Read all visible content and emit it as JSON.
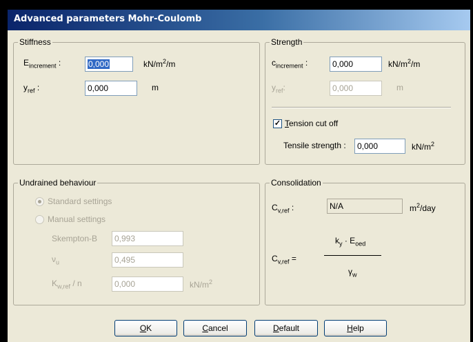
{
  "window": {
    "title": "Advanced parameters Mohr-Coulomb"
  },
  "stiffness": {
    "legend": "Stiffness",
    "e_increment": {
      "symbol": "E",
      "sub": "increment",
      "colon": " :",
      "value": "0,000",
      "unit": "kN/m",
      "unit_sup": "2",
      "unit_tail": "/m"
    },
    "y_ref": {
      "symbol": "y",
      "sub": "ref",
      "colon": " :",
      "value": "0,000",
      "unit": "m"
    }
  },
  "strength": {
    "legend": "Strength",
    "c_increment": {
      "symbol": "c",
      "sub": "increment",
      "colon": " :",
      "value": "0,000",
      "unit": "kN/m",
      "unit_sup": "2",
      "unit_tail": "/m"
    },
    "y_ref": {
      "symbol": "y",
      "sub": "ref",
      "colon": ":",
      "value": "0,000",
      "unit": "m"
    },
    "tension_cutoff": {
      "label_first": "T",
      "label_rest": "ension cut off",
      "checked": true,
      "check_glyph": "✓"
    },
    "tensile_strength": {
      "label": "Tensile strength :",
      "value": "0,000",
      "unit": "kN/m",
      "unit_sup": "2"
    }
  },
  "undrained": {
    "legend": "Undrained behaviour",
    "standard": {
      "label": "Standard settings",
      "selected": true
    },
    "manual": {
      "label": "Manual settings",
      "selected": false
    },
    "skempton": {
      "label": "Skempton-B",
      "value": "0,993"
    },
    "nu_u": {
      "symbol": "ν",
      "sub": "u",
      "value": "0,495"
    },
    "kw": {
      "symbol": "K",
      "sub": "w,ref",
      "tail": " / n",
      "value": "0,000",
      "unit": "kN/m",
      "unit_sup": "2"
    }
  },
  "consolidation": {
    "legend": "Consolidation",
    "cv_ref": {
      "symbol": "C",
      "sub": "v,ref",
      "colon": " :",
      "value": "N/A",
      "unit": "m",
      "unit_sup": "2",
      "unit_tail": "/day"
    },
    "formula": {
      "lhs_symbol": "C",
      "lhs_sub": "v,ref",
      "eq": " =",
      "num_k": "k",
      "num_k_sub": "y",
      "num_dot": " · ",
      "num_e": "E",
      "num_e_sub": "oed",
      "den": "γ",
      "den_sub": "w"
    }
  },
  "buttons": {
    "ok": {
      "u": "O",
      "rest": "K"
    },
    "cancel": {
      "u": "C",
      "rest": "ancel"
    },
    "default": {
      "u": "D",
      "rest": "efault"
    },
    "help": {
      "u": "H",
      "rest": "elp"
    }
  },
  "colors": {
    "titlebar_start": "#0a246a",
    "titlebar_end": "#a6caf0",
    "dialog_bg": "#ece9d8",
    "disabled_text": "#a7a395",
    "selection": "#316ac5"
  }
}
